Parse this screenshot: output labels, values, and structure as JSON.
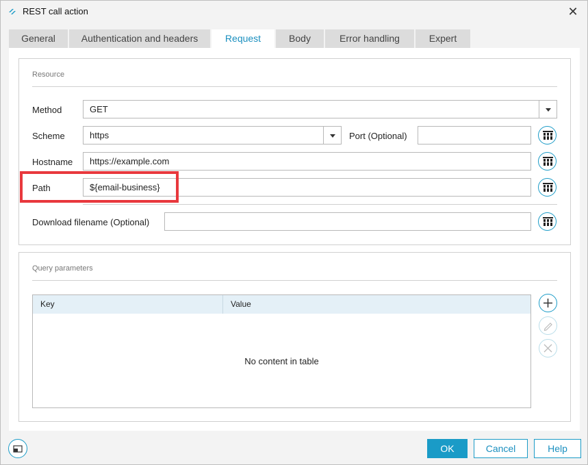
{
  "window": {
    "title": "REST call action"
  },
  "tabs": [
    {
      "label": "General"
    },
    {
      "label": "Authentication and headers"
    },
    {
      "label": "Request"
    },
    {
      "label": "Body"
    },
    {
      "label": "Error handling"
    },
    {
      "label": "Expert"
    }
  ],
  "active_tab": "Request",
  "resource": {
    "title": "Resource",
    "method": {
      "label": "Method",
      "value": "GET"
    },
    "scheme": {
      "label": "Scheme",
      "value": "https"
    },
    "port": {
      "label": "Port (Optional)",
      "value": ""
    },
    "hostname": {
      "label": "Hostname",
      "value": "https://example.com"
    },
    "path": {
      "label": "Path",
      "value": "${email-business}"
    },
    "download_filename": {
      "label": "Download filename (Optional)",
      "value": ""
    }
  },
  "query": {
    "title": "Query parameters",
    "columns": [
      "Key",
      "Value"
    ],
    "empty_text": "No content in table"
  },
  "footer": {
    "ok_label": "OK",
    "cancel_label": "Cancel",
    "help_label": "Help"
  },
  "colors": {
    "accent": "#1a9bc7",
    "highlight": "#e8383d",
    "table_header": "#e4f0f7"
  }
}
